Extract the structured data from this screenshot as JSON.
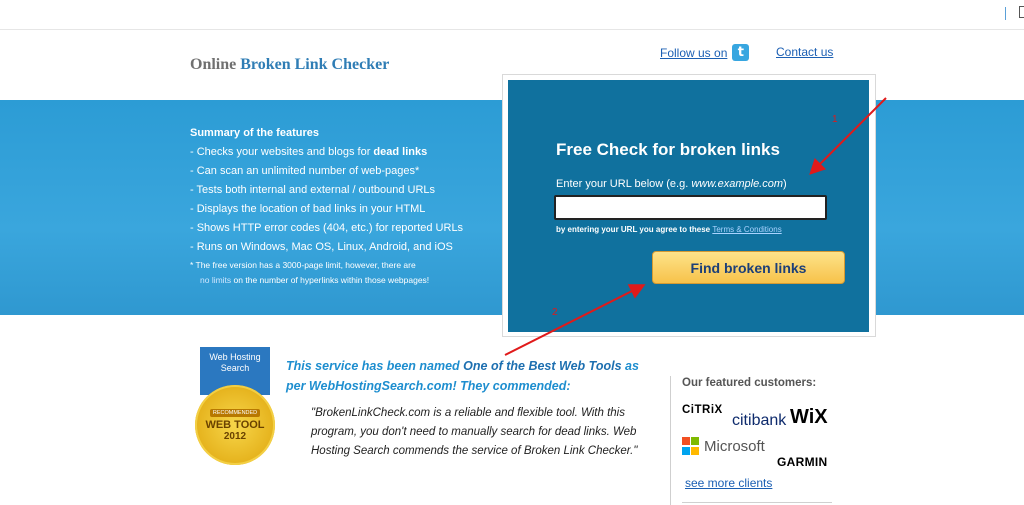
{
  "header": {
    "logo_part1": "Online",
    "logo_part2": "Broken Link Checker",
    "follow_label": "Follow us on",
    "twitter_icon": "twitter-icon",
    "contact_label": "Contact us"
  },
  "features": {
    "title": "Summary of the features",
    "items": [
      {
        "prefix": "- Checks your websites and blogs for ",
        "bold": "dead links"
      },
      {
        "text": "- Can scan an unlimited number of web-pages*"
      },
      {
        "text": "- Tests both internal and external / outbound URLs"
      },
      {
        "text": "- Displays the location of bad links in your HTML"
      },
      {
        "text": "- Shows HTTP error codes (404, etc.) for reported URLs"
      },
      {
        "text": "- Runs on Windows, Mac OS, Linux, Android, and iOS"
      }
    ],
    "footnote_line1": "*  The free version has a 3000-page limit, however, there are",
    "footnote_nolimits": "no limits",
    "footnote_line2": " on the number of hyperlinks within those webpages!"
  },
  "form": {
    "title": "Free Check for broken links",
    "url_label": "Enter your URL below (e.g. ",
    "url_example": "www.example.com",
    "url_label_end": ")",
    "url_value": "",
    "agree_text": "by entering your URL you agree to these ",
    "terms_label": "Terms & Conditions",
    "submit_label": "Find broken links",
    "marker1": "1",
    "marker2": "2"
  },
  "award": {
    "badge_line1": "Web Hosting",
    "badge_line2": "Search",
    "badge_recommended": "RECOMMENDED",
    "badge_webtool": "WEB TOOL",
    "badge_year": "2012",
    "line1_a": "This service has been named ",
    "line1_b": "One of the Best Web Tools",
    "line1_c": " as",
    "line2": "per WebHostingSearch.com! They commended:",
    "quote": "\"BrokenLinkCheck.com is a reliable and flexible tool. With this program, you don't need to manually search for dead links. Web Hosting Search commends the service of Broken Link Checker.\""
  },
  "customers": {
    "title": "Our featured customers:",
    "citrix": "CiTRiX",
    "citi": "citi",
    "bank": "bank",
    "wix": "WiX",
    "microsoft": "Microsoft",
    "garmin": "GARMIN",
    "more_label": "see more clients"
  },
  "colors": {
    "band": "#3aa6dd",
    "panel": "#10719e",
    "button": "#f7c24a",
    "link": "#1b5fb3",
    "annotation": "#e01a1a"
  }
}
